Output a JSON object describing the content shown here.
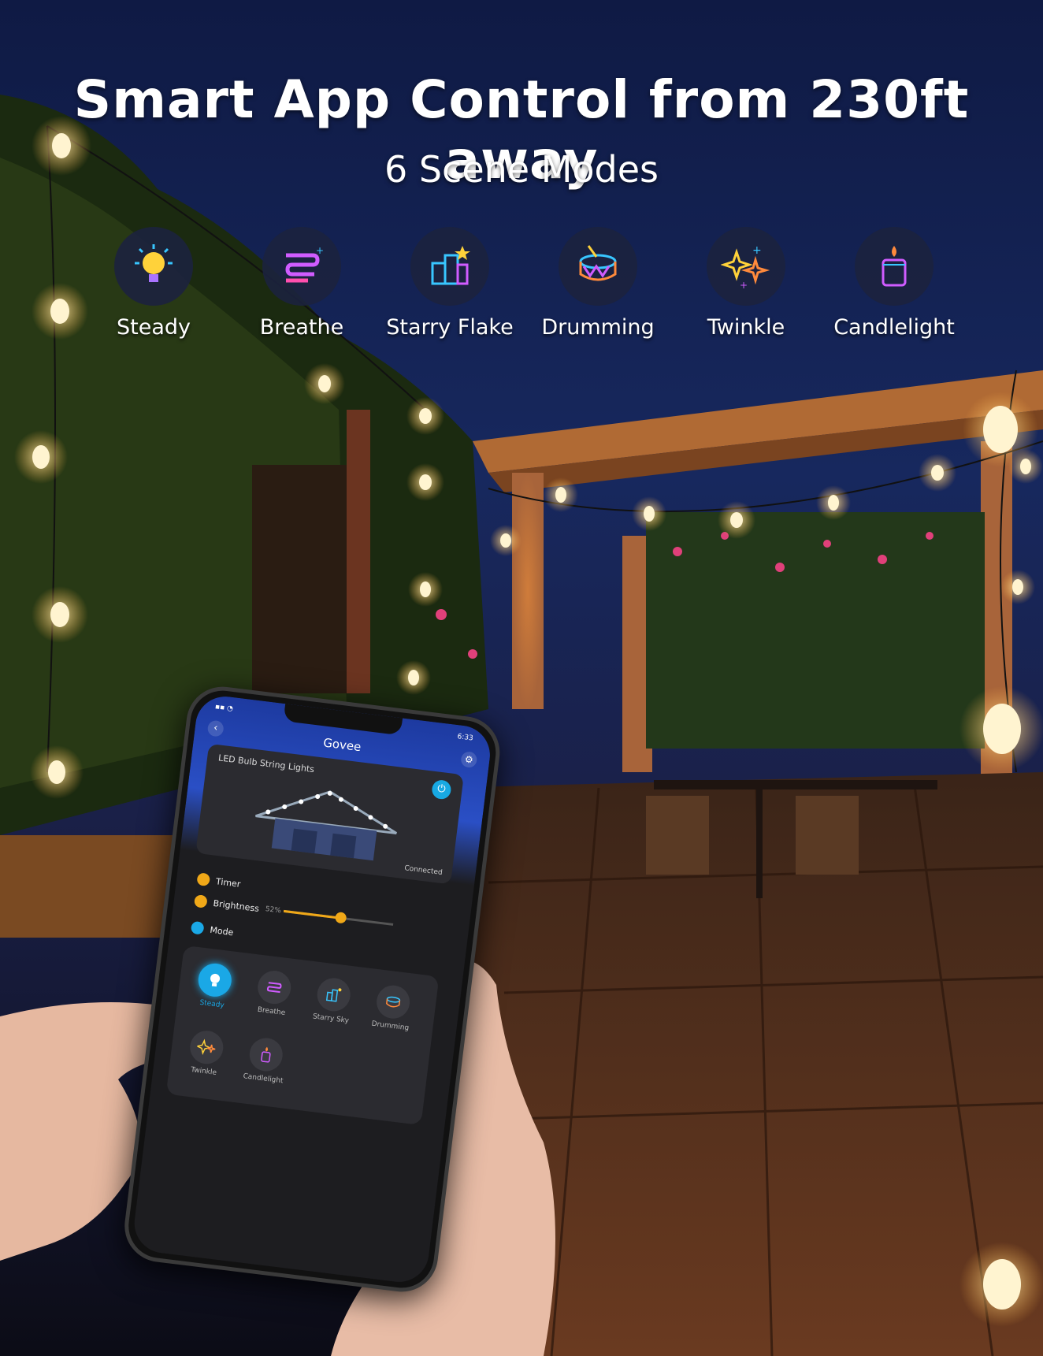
{
  "headline": {
    "title": "Smart App Control from 230ft away",
    "subtitle": "6 Scene Modes"
  },
  "scene_modes": [
    {
      "label": "Steady",
      "icon": "bulb-icon"
    },
    {
      "label": "Breathe",
      "icon": "breathe-icon"
    },
    {
      "label": "Starry Flake",
      "icon": "starry-icon"
    },
    {
      "label": "Drumming",
      "icon": "drum-icon"
    },
    {
      "label": "Twinkle",
      "icon": "twinkle-icon"
    },
    {
      "label": "Candlelight",
      "icon": "candle-icon"
    }
  ],
  "phone": {
    "status_time": "6:33",
    "app_title": "Govee",
    "device_name": "LED Bulb String Lights",
    "connection_status": "Connected",
    "timer_label": "Timer",
    "brightness_label": "Brightness",
    "brightness_value": "52%",
    "brightness_level": 0.52,
    "mode_label": "Mode",
    "modes": [
      "Steady",
      "Breathe",
      "Starry Sky",
      "Drumming",
      "Twinkle",
      "Candlelight"
    ],
    "active_mode": "Steady"
  },
  "colors": {
    "sky": "#132054",
    "accent_blue": "#1aa8e6",
    "accent_orange": "#f0a818",
    "bulb_glow": "#ffe9b8"
  }
}
